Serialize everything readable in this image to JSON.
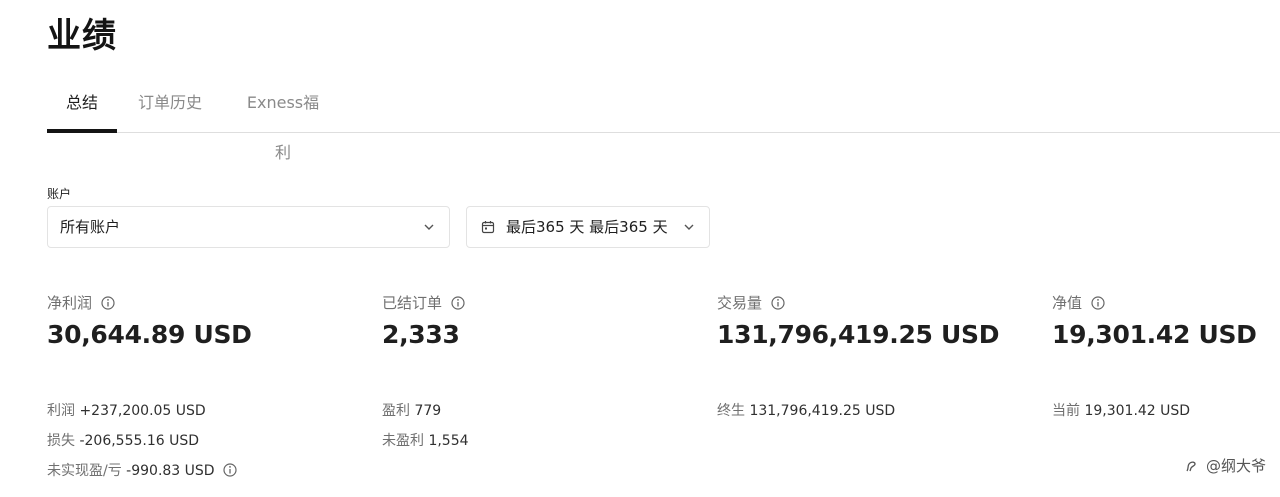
{
  "page": {
    "title": "业绩"
  },
  "tabs": [
    {
      "label": "总结",
      "active": true
    },
    {
      "label": "订单历史",
      "active": false
    },
    {
      "label": "Exness福利",
      "active": false
    }
  ],
  "filters": {
    "account_label": "账户",
    "account_value": "所有账户",
    "period_value": "最后365 天 最后365 天"
  },
  "stats": {
    "net_profit": {
      "label": "净利润",
      "value": "30,644.89 USD",
      "profit_key": "利润",
      "profit_value": "+237,200.05 USD",
      "loss_key": "损失",
      "loss_value": "-206,555.16 USD",
      "unrealized_key": "未实现盈/亏",
      "unrealized_value": "-990.83 USD"
    },
    "closed_orders": {
      "label": "已结订单",
      "value": "2,333",
      "win_key": "盈利",
      "win_value": "779",
      "loss_key": "未盈利",
      "loss_value": "1,554"
    },
    "volume": {
      "label": "交易量",
      "value": "131,796,419.25 USD",
      "lifetime_key": "终生",
      "lifetime_value": "131,796,419.25 USD"
    },
    "equity": {
      "label": "净值",
      "value": "19,301.42 USD",
      "current_key": "当前",
      "current_value": "19,301.42 USD"
    }
  },
  "watermark": {
    "text": "@纲大爷"
  },
  "icons": {
    "info": "info-circle-icon",
    "chevron": "chevron-down-icon",
    "calendar": "calendar-icon"
  },
  "colors": {
    "text": "#1f1f1f",
    "muted": "#707070",
    "border": "#e3e3e3",
    "tab_active": "#141414"
  }
}
